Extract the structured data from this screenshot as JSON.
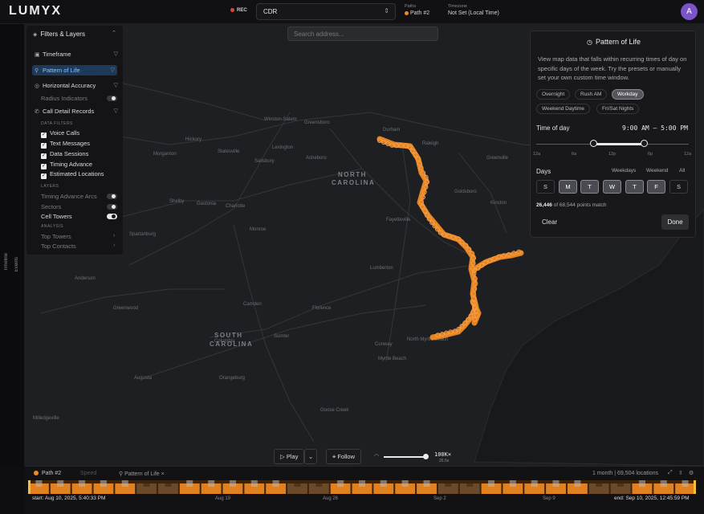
{
  "header": {
    "logo": "LUMYX",
    "rec_label": "REC",
    "source_select": "CDR",
    "paths_label": "Paths",
    "paths_value": "Path #2",
    "timezone_label": "Timezone",
    "timezone_value": "Not Set (Local Time)",
    "avatar_initial": "A"
  },
  "rail": {
    "timeline": "Timeline",
    "events": "Events"
  },
  "map": {
    "search_placeholder": "Search address...",
    "state_labels": [
      "NORTH",
      "CAROLINA",
      "SOUTH",
      "CAROLINA"
    ],
    "cities": [
      "Winston-Salem",
      "Greensboro",
      "Durham",
      "Raleigh",
      "Statesville",
      "Lexington",
      "Salisbury",
      "Asheboro",
      "Morganton",
      "Hickory",
      "Shelby",
      "Gastonia",
      "Charlotte",
      "Spartanburg",
      "Monroe",
      "Fayetteville",
      "Goldsboro",
      "Kinston",
      "Greenville",
      "Lumberton",
      "Anderson",
      "Greenwood",
      "Florence",
      "Conway",
      "North Myrtle Beach",
      "Myrtle Beach",
      "Sumter",
      "Columbia",
      "Orangeburg",
      "Augusta",
      "Milledgeville",
      "Goose Creek",
      "Camden"
    ]
  },
  "filters": {
    "title": "Filters & Layers",
    "timeframe": "Timeframe",
    "pattern_of_life": "Pattern of Life",
    "horizontal_accuracy": "Horizontal Accuracy",
    "radius_indicators": "Radius Indicators",
    "call_detail_records": "Call Detail Records",
    "data_filters_label": "DATA FILTERS",
    "data_filters": [
      "Voice Calls",
      "Text Messages",
      "Data Sessions",
      "Timing Advance",
      "Estimated Locations"
    ],
    "layers_label": "LAYERS",
    "layers": [
      {
        "label": "Timing Advance Arcs",
        "on": false
      },
      {
        "label": "Sectors",
        "on": false
      },
      {
        "label": "Cell Towers",
        "on": true
      }
    ],
    "analysis_label": "ANALYSIS",
    "analysis": [
      "Top Towers",
      "Top Contacts"
    ]
  },
  "pattern_panel": {
    "title": "Pattern of Life",
    "description": "View map data that falls within recurring times of day on specific days of the week. Try the presets or manually set your own custom time window.",
    "presets": [
      "Overnight",
      "Rush AM",
      "Workday",
      "Weekend Daytime",
      "Fri/Sat Nights"
    ],
    "selected_preset": "Workday",
    "time_of_day_label": "Time of day",
    "time_range": "9:00 AM – 5:00 PM",
    "time_start_hour": 9,
    "time_end_hour": 17,
    "ticks": [
      "12a",
      "6a",
      "12p",
      "6p",
      "12a"
    ],
    "days_label": "Days",
    "day_presets": [
      "Weekdays",
      "Weekend",
      "All"
    ],
    "days": [
      {
        "label": "S",
        "on": false
      },
      {
        "label": "M",
        "on": true
      },
      {
        "label": "T",
        "on": true
      },
      {
        "label": "W",
        "on": true
      },
      {
        "label": "T",
        "on": true
      },
      {
        "label": "F",
        "on": true
      },
      {
        "label": "S",
        "on": false
      }
    ],
    "match_count": "26,446",
    "match_suffix": "of 68,544 points match",
    "clear": "Clear",
    "done": "Done"
  },
  "playback": {
    "play": "Play",
    "follow": "Follow",
    "speed": "100K×",
    "speed_sub": "26.5s"
  },
  "timeline": {
    "path_label": "Path #2",
    "speed_tab": "Speed",
    "pattern_tab": "Pattern of Life",
    "summary": "1 month  |  69,504 locations",
    "start": "start: Aug 10, 2025, 5:40:33 PM",
    "end": "end: Sep 10, 2025, 12:45:59 PM",
    "dates": [
      "Aug 19",
      "Aug 26",
      "Sep 2",
      "Sep 9"
    ]
  },
  "colors": {
    "accent": "#f08a24",
    "map_bg": "#1e1f22",
    "panel_bg": "#18181b",
    "active_blue": "#8ec2ff"
  }
}
